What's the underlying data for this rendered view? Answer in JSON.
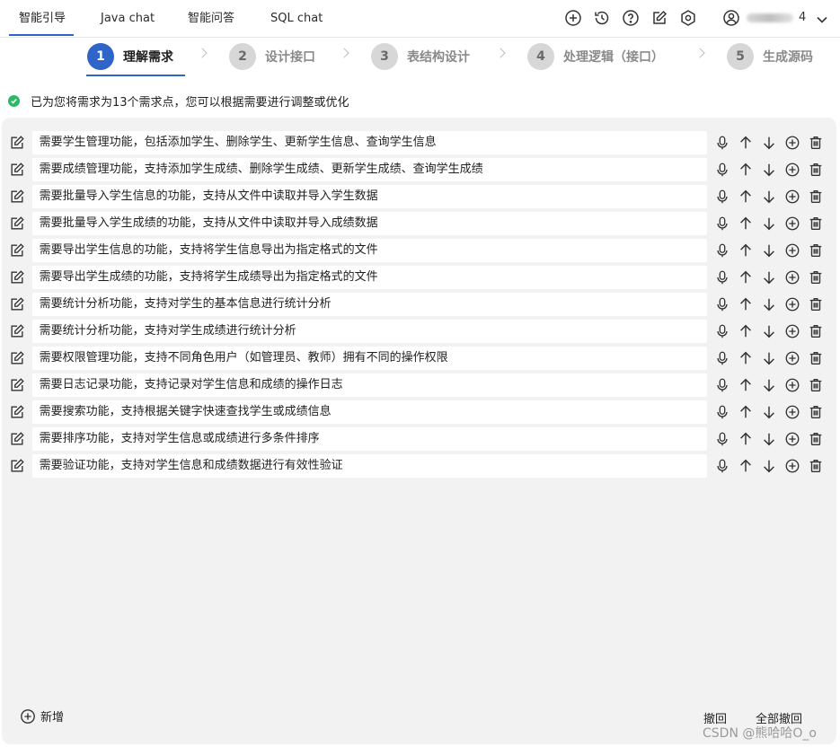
{
  "nav": {
    "tabs": [
      "智能引导",
      "Java chat",
      "智能问答",
      "SQL chat"
    ],
    "active_tab": "智能引导",
    "icons": [
      "plus-circle-icon",
      "history-icon",
      "help-icon",
      "edit-icon",
      "settings-icon"
    ],
    "user": {
      "name_suffix": "4",
      "icon": "user-icon"
    }
  },
  "steps": [
    {
      "num": "1",
      "label": "理解需求",
      "active": true
    },
    {
      "num": "2",
      "label": "设计接口",
      "active": false
    },
    {
      "num": "3",
      "label": "表结构设计",
      "active": false
    },
    {
      "num": "4",
      "label": "处理逻辑（接口）",
      "active": false
    },
    {
      "num": "5",
      "label": "生成源码",
      "active": false
    }
  ],
  "notice": "已为您将需求为13个需求点，您可以根据需要进行调整或优化",
  "requirements": [
    "需要学生管理功能，包括添加学生、删除学生、更新学生信息、查询学生信息",
    "需要成绩管理功能，支持添加学生成绩、删除学生成绩、更新学生成绩、查询学生成绩",
    "需要批量导入学生信息的功能，支持从文件中读取并导入学生数据",
    "需要批量导入学生成绩的功能，支持从文件中读取并导入成绩数据",
    "需要导出学生信息的功能，支持将学生信息导出为指定格式的文件",
    "需要导出学生成绩的功能，支持将学生成绩导出为指定格式的文件",
    "需要统计分析功能，支持对学生的基本信息进行统计分析",
    "需要统计分析功能，支持对学生成绩进行统计分析",
    "需要权限管理功能，支持不同角色用户（如管理员、教师）拥有不同的操作权限",
    "需要日志记录功能，支持记录对学生信息和成绩的操作日志",
    "需要搜索功能，支持根据关键字快速查找学生或成绩信息",
    "需要排序功能，支持对学生信息或成绩进行多条件排序",
    "需要验证功能，支持对学生信息和成绩数据进行有效性验证"
  ],
  "footer": {
    "add_label": "新增",
    "undo_label": "撤回",
    "undo_all_label": "全部撤回"
  },
  "watermark": "CSDN @熊哈哈O_o",
  "colors": {
    "accent": "#2f64c8",
    "success": "#2db864",
    "panel_bg": "#f2f2f2"
  }
}
